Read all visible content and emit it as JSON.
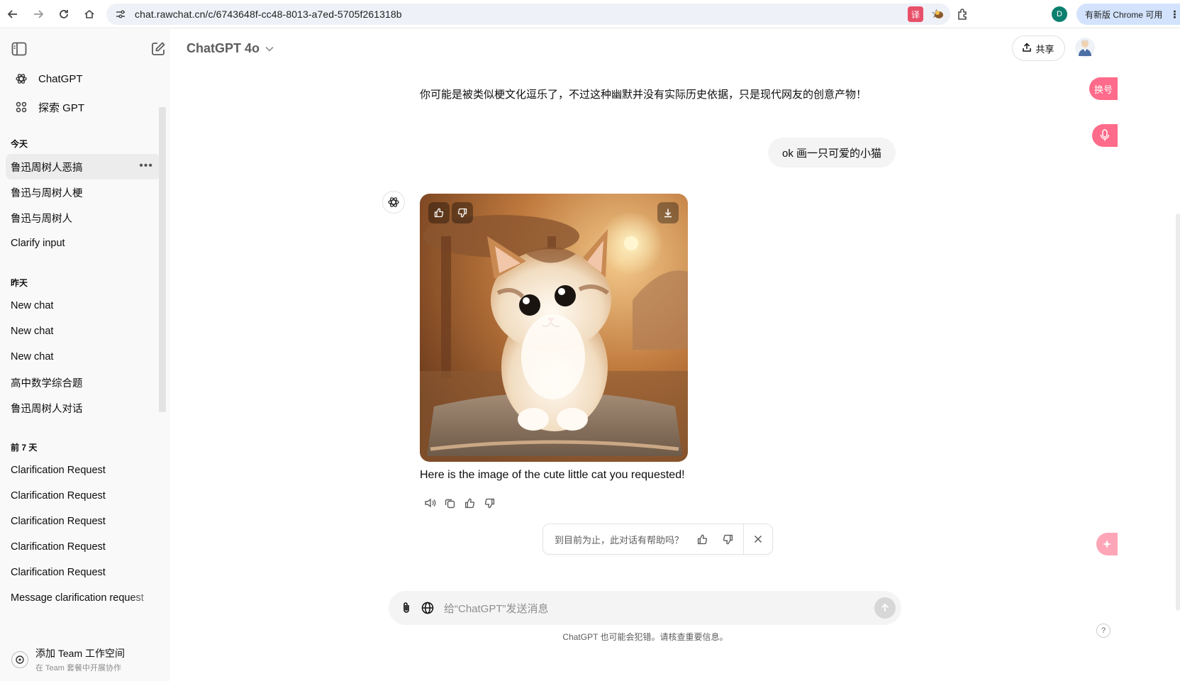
{
  "browser": {
    "url": "chat.rawchat.cn/c/6743648f-cc48-8013-a7ed-5705f261318b",
    "profile_initial": "D",
    "update_label": "有新版 Chrome 可用"
  },
  "sidebar": {
    "nav": [
      {
        "label": "ChatGPT",
        "icon": "openai-logo-icon"
      },
      {
        "label": "探索 GPT",
        "icon": "grid-icon"
      }
    ],
    "sections": [
      {
        "title": "今天",
        "items": [
          "鲁迅周树人恶搞",
          "鲁迅与周树人梗",
          "鲁迅与周树人",
          "Clarify input"
        ]
      },
      {
        "title": "昨天",
        "items": [
          "New chat",
          "New chat",
          "New chat",
          "高中数学综合题",
          "鲁迅周树人对话"
        ]
      },
      {
        "title": "前 7 天",
        "items": [
          "Clarification Request",
          "Clarification Request",
          "Clarification Request",
          "Clarification Request",
          "Clarification Request",
          "Message clarification request"
        ]
      }
    ],
    "footer": {
      "title": "添加 Team 工作空间",
      "subtitle": "在 Team 套餐中开展协作"
    }
  },
  "header": {
    "model": "ChatGPT 4o",
    "share_label": "共享"
  },
  "conversation": {
    "previous_reply": "你可能是被类似梗文化逗乐了，不过这种幽默并没有实际历史依据，只是现代网友的创意产物！",
    "user_message": "ok 画一只可爱的小猫",
    "assistant_reply": "Here is the image of the cute little cat you requested!"
  },
  "feedback": {
    "question": "到目前为止，此对话有帮助吗？"
  },
  "composer": {
    "placeholder": "给“ChatGPT”发送消息",
    "disclaimer": "ChatGPT 也可能会犯错。请核查重要信息。"
  },
  "floaters": {
    "top_label": "换号"
  },
  "help_label": "?"
}
